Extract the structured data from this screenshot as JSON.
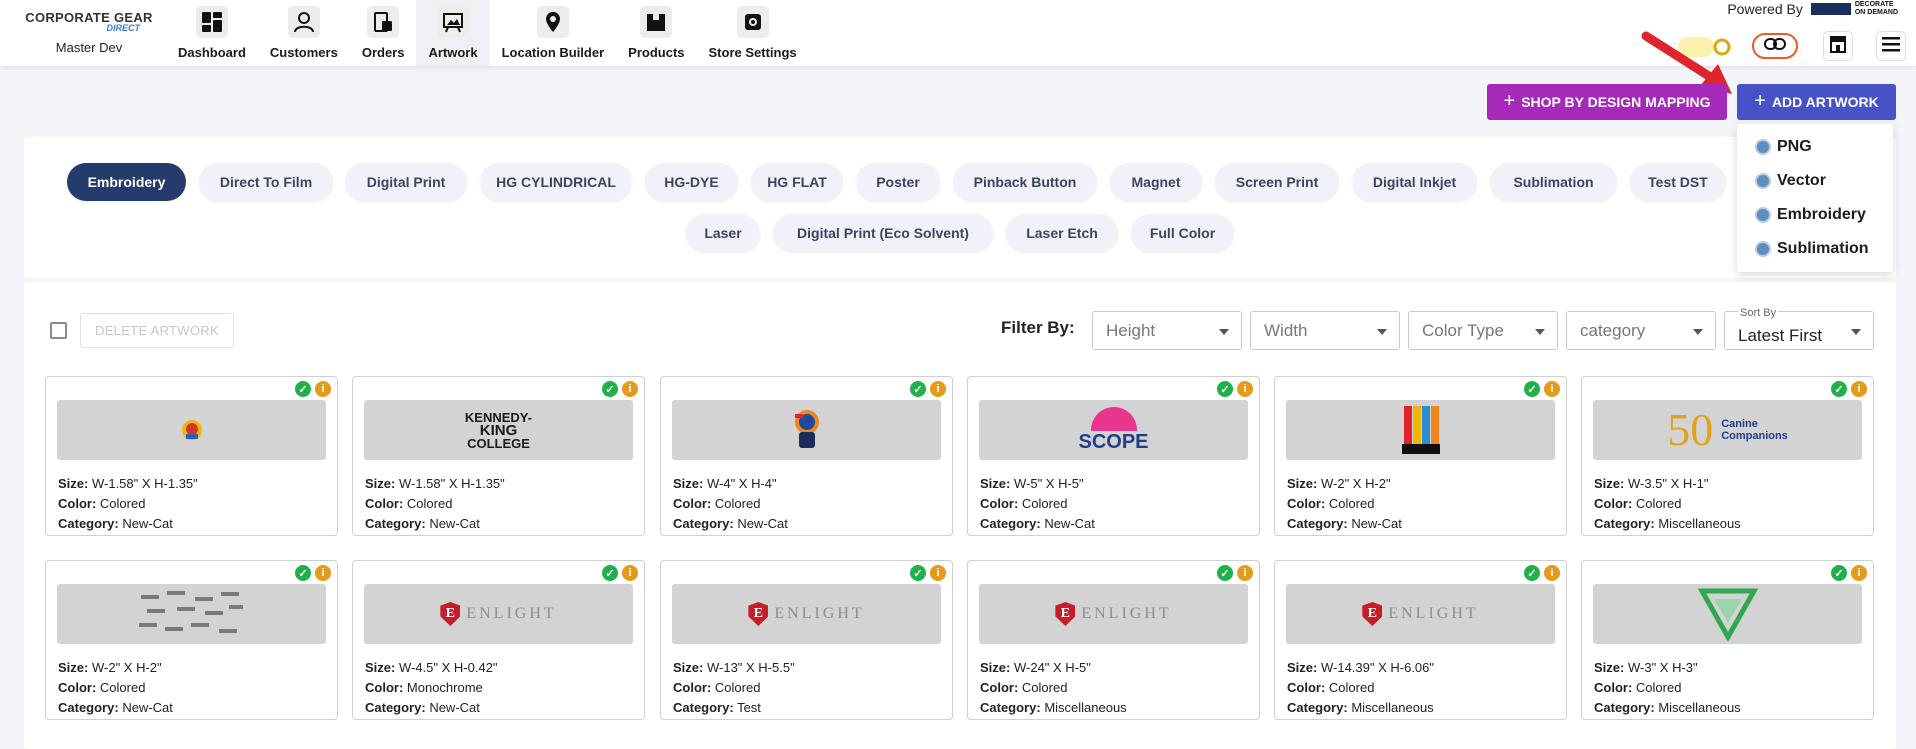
{
  "brand": {
    "logo_text": "CORPORATE GEAR",
    "logo_sub": "DIRECT",
    "store_name": "Master Dev"
  },
  "nav": [
    {
      "label": "Dashboard",
      "icon": "dashboard-icon"
    },
    {
      "label": "Customers",
      "icon": "user-icon"
    },
    {
      "label": "Orders",
      "icon": "orders-icon"
    },
    {
      "label": "Artwork",
      "icon": "artwork-icon",
      "active": true
    },
    {
      "label": "Location Builder",
      "icon": "location-pin-icon"
    },
    {
      "label": "Products",
      "icon": "box-icon"
    },
    {
      "label": "Store Settings",
      "icon": "settings-icon"
    }
  ],
  "header": {
    "powered_by": "Powered By",
    "partner_logo_line1": "DECORATE",
    "partner_logo_line2": "ON DEMAND"
  },
  "actions": {
    "shop_by_design": "SHOP BY DESIGN MAPPING",
    "add_artwork": "ADD ARTWORK"
  },
  "add_menu": [
    "PNG",
    "Vector",
    "Embroidery",
    "Sublimation"
  ],
  "categories": [
    "Embroidery",
    "Direct To Film",
    "Digital Print",
    "HG CYLINDRICAL",
    "HG-DYE",
    "HG FLAT",
    "Poster",
    "Pinback Button",
    "Magnet",
    "Screen Print",
    "Digital Inkjet",
    "Sublimation",
    "Test DST",
    "Laser",
    "Digital Print (Eco Solvent)",
    "Laser Etch",
    "Full Color"
  ],
  "active_category": "Embroidery",
  "list": {
    "delete_label": "DELETE ARTWORK",
    "filter_label": "Filter By:"
  },
  "filters": {
    "height": "Height",
    "width": "Width",
    "color_type": "Color Type",
    "category": "category",
    "sort_caption": "Sort By",
    "sort_value": "Latest First"
  },
  "labels": {
    "size": "Size:",
    "color": "Color:",
    "category": "Category:"
  },
  "colors": {
    "primary": "#4652c6",
    "shop_button": "#a52aba",
    "active_chip": "#243b6b",
    "approved": "#21b14b",
    "info": "#e59a1a"
  },
  "artworks": [
    {
      "size": "W-1.58\" X H-1.35\"",
      "color": "Colored",
      "category": "New-Cat",
      "thumb": "mascot-logo"
    },
    {
      "size": "W-1.58\" X H-1.35\"",
      "color": "Colored",
      "category": "New-Cat",
      "thumb": "kennedy-king-logo",
      "thumb_line1": "KENNEDY-",
      "thumb_line2": "KING",
      "thumb_line3": "COLLEGE"
    },
    {
      "size": "W-4\" X H-4\"",
      "color": "Colored",
      "category": "New-Cat",
      "thumb": "character-logo"
    },
    {
      "size": "W-5\" X H-5\"",
      "color": "Colored",
      "category": "New-Cat",
      "thumb": "scope-logo",
      "thumb_text": "SCOPE"
    },
    {
      "size": "W-2\" X H-2\"",
      "color": "Colored",
      "category": "New-Cat",
      "thumb": "striped-logo"
    },
    {
      "size": "W-3.5\" X H-1\"",
      "color": "Colored",
      "category": "Miscellaneous",
      "thumb": "canine-companions-logo",
      "thumb_text": "50",
      "thumb_line1": "Canine",
      "thumb_line2": "Companions"
    },
    {
      "size": "W-2\" X H-2\"",
      "color": "Colored",
      "category": "New-Cat",
      "thumb": "pattern-logo"
    },
    {
      "size": "W-4.5\" X H-0.42\"",
      "color": "Monochrome",
      "category": "New-Cat",
      "thumb": "enlight-logo",
      "thumb_text": "ENLIGHT"
    },
    {
      "size": "W-13\" X H-5.5\"",
      "color": "Colored",
      "category": "Test",
      "thumb": "enlight-logo",
      "thumb_text": "ENLIGHT"
    },
    {
      "size": "W-24\" X H-5\"",
      "color": "Colored",
      "category": "Miscellaneous",
      "thumb": "enlight-logo",
      "thumb_text": "ENLIGHT"
    },
    {
      "size": "W-14.39\" X H-6.06\"",
      "color": "Colored",
      "category": "Miscellaneous",
      "thumb": "enlight-logo",
      "thumb_text": "ENLIGHT"
    },
    {
      "size": "W-3\" X H-3\"",
      "color": "Colored",
      "category": "Miscellaneous",
      "thumb": "green-monogram-logo"
    }
  ]
}
